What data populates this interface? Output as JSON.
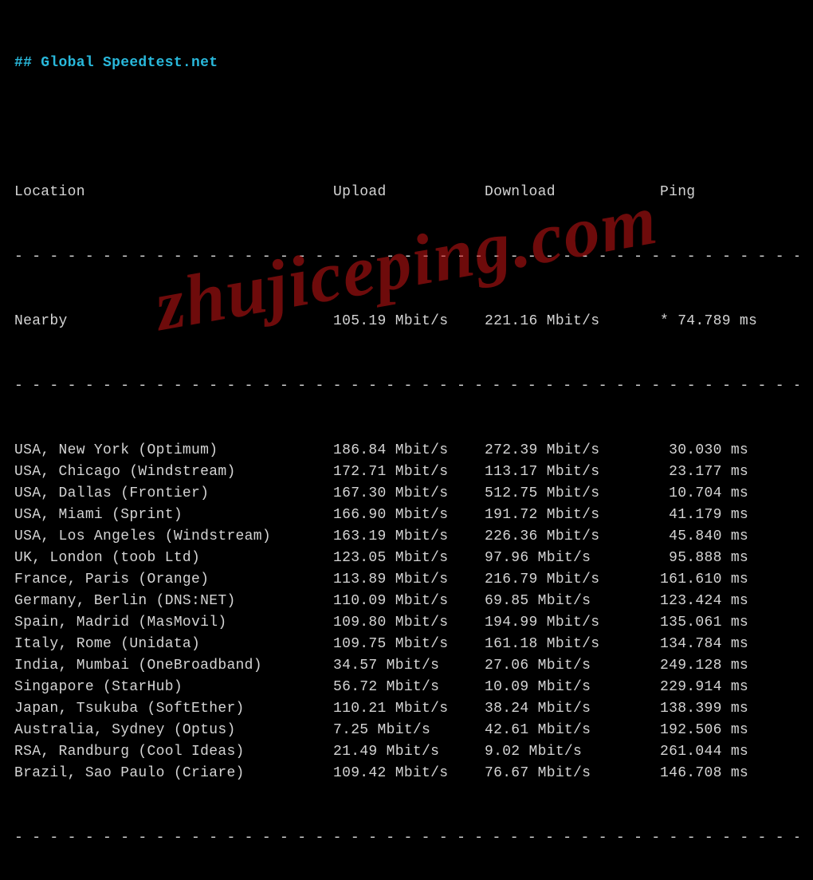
{
  "heading": "## Global Speedtest.net",
  "headers": {
    "location": "Location",
    "upload": "Upload",
    "download": "Download",
    "ping": "Ping"
  },
  "nearby": {
    "location": "Nearby",
    "upload": "105.19 Mbit/s",
    "download": "221.16 Mbit/s",
    "ping": "* 74.789 ms"
  },
  "rows": [
    {
      "location": "USA, New York (Optimum)",
      "upload": "186.84 Mbit/s",
      "download": "272.39 Mbit/s",
      "ping": " 30.030 ms"
    },
    {
      "location": "USA, Chicago (Windstream)",
      "upload": "172.71 Mbit/s",
      "download": "113.17 Mbit/s",
      "ping": " 23.177 ms"
    },
    {
      "location": "USA, Dallas (Frontier)",
      "upload": "167.30 Mbit/s",
      "download": "512.75 Mbit/s",
      "ping": " 10.704 ms"
    },
    {
      "location": "USA, Miami (Sprint)",
      "upload": "166.90 Mbit/s",
      "download": "191.72 Mbit/s",
      "ping": " 41.179 ms"
    },
    {
      "location": "USA, Los Angeles (Windstream)",
      "upload": "163.19 Mbit/s",
      "download": "226.36 Mbit/s",
      "ping": " 45.840 ms"
    },
    {
      "location": "UK, London (toob Ltd)",
      "upload": "123.05 Mbit/s",
      "download": "97.96 Mbit/s",
      "ping": " 95.888 ms"
    },
    {
      "location": "France, Paris (Orange)",
      "upload": "113.89 Mbit/s",
      "download": "216.79 Mbit/s",
      "ping": "161.610 ms"
    },
    {
      "location": "Germany, Berlin (DNS:NET)",
      "upload": "110.09 Mbit/s",
      "download": "69.85 Mbit/s",
      "ping": "123.424 ms"
    },
    {
      "location": "Spain, Madrid (MasMovil)",
      "upload": "109.80 Mbit/s",
      "download": "194.99 Mbit/s",
      "ping": "135.061 ms"
    },
    {
      "location": "Italy, Rome (Unidata)",
      "upload": "109.75 Mbit/s",
      "download": "161.18 Mbit/s",
      "ping": "134.784 ms"
    },
    {
      "location": "India, Mumbai (OneBroadband)",
      "upload": "34.57 Mbit/s",
      "download": "27.06 Mbit/s",
      "ping": "249.128 ms"
    },
    {
      "location": "Singapore (StarHub)",
      "upload": "56.72 Mbit/s",
      "download": "10.09 Mbit/s",
      "ping": "229.914 ms"
    },
    {
      "location": "Japan, Tsukuba (SoftEther)",
      "upload": "110.21 Mbit/s",
      "download": "38.24 Mbit/s",
      "ping": "138.399 ms"
    },
    {
      "location": "Australia, Sydney (Optus)",
      "upload": "7.25 Mbit/s",
      "download": "42.61 Mbit/s",
      "ping": "192.506 ms"
    },
    {
      "location": "RSA, Randburg (Cool Ideas)",
      "upload": "21.49 Mbit/s",
      "download": "9.02 Mbit/s",
      "ping": "261.044 ms"
    },
    {
      "location": "Brazil, Sao Paulo (Criare)",
      "upload": "109.42 Mbit/s",
      "download": "76.67 Mbit/s",
      "ping": "146.708 ms"
    }
  ],
  "watermark": "zhujiceping.com"
}
